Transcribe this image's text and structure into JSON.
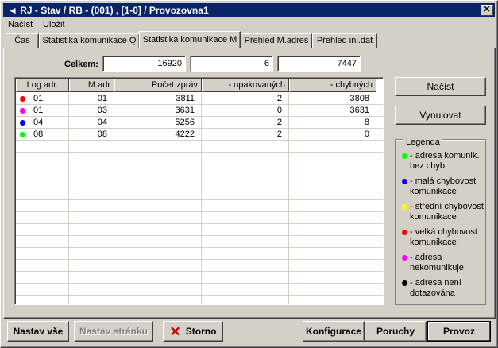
{
  "window": {
    "title": "RJ - Stav / RB - (001) , [1-0] / Provozovna1"
  },
  "menu": {
    "items": [
      "Načíst",
      "Uložit"
    ]
  },
  "tabs": [
    "Čas",
    "Statistika komunikace Q",
    "Statistika komunikace M",
    "Přehled M.adres",
    "Přehled ini.dat"
  ],
  "active_tab": "Statistika komunikace M",
  "totals": {
    "label": "Celkem:",
    "values": [
      "16920",
      "6",
      "7447"
    ]
  },
  "table": {
    "headers": [
      "Log.adr.",
      "M.adr",
      "Počet zpráv",
      "- opakovaných",
      "- chybných"
    ],
    "rows": [
      {
        "dot": "#ff0000",
        "log": "01",
        "madr": "01",
        "pocet": "3811",
        "opak": "2",
        "chyb": "3808"
      },
      {
        "dot": "#ff00ff",
        "log": "01",
        "madr": "03",
        "pocet": "3631",
        "opak": "0",
        "chyb": "3631"
      },
      {
        "dot": "#0000ff",
        "log": "04",
        "madr": "04",
        "pocet": "5256",
        "opak": "2",
        "chyb": "8"
      },
      {
        "dot": "#00ff00",
        "log": "08",
        "madr": "08",
        "pocet": "4222",
        "opak": "2",
        "chyb": "0"
      }
    ]
  },
  "buttons": {
    "nacist": "Načíst",
    "vynulovat": "Vynulovat"
  },
  "legend": {
    "title": "Legenda",
    "items": [
      {
        "color": "#00ff00",
        "text": "- adresa komunik.\nbez chyb"
      },
      {
        "color": "#0000ff",
        "text": "- malá chybovost\nkomunikace"
      },
      {
        "color": "#ffff00",
        "text": "- střední chybovost\nkomunikace"
      },
      {
        "color": "#ff0000",
        "text": "- velká chybovost\nkomunikace"
      },
      {
        "color": "#ff00ff",
        "text": "- adresa\nnekomunikuje"
      },
      {
        "color": "#000000",
        "text": "- adresa není\ndotazována"
      }
    ]
  },
  "bottom": {
    "nastav_vse": "Nastav vše",
    "nastav_stranku": "Nastav stránku",
    "storno": "Storno",
    "konfigurace": "Konfigurace",
    "poruchy": "Poruchy",
    "provoz": "Provoz"
  }
}
